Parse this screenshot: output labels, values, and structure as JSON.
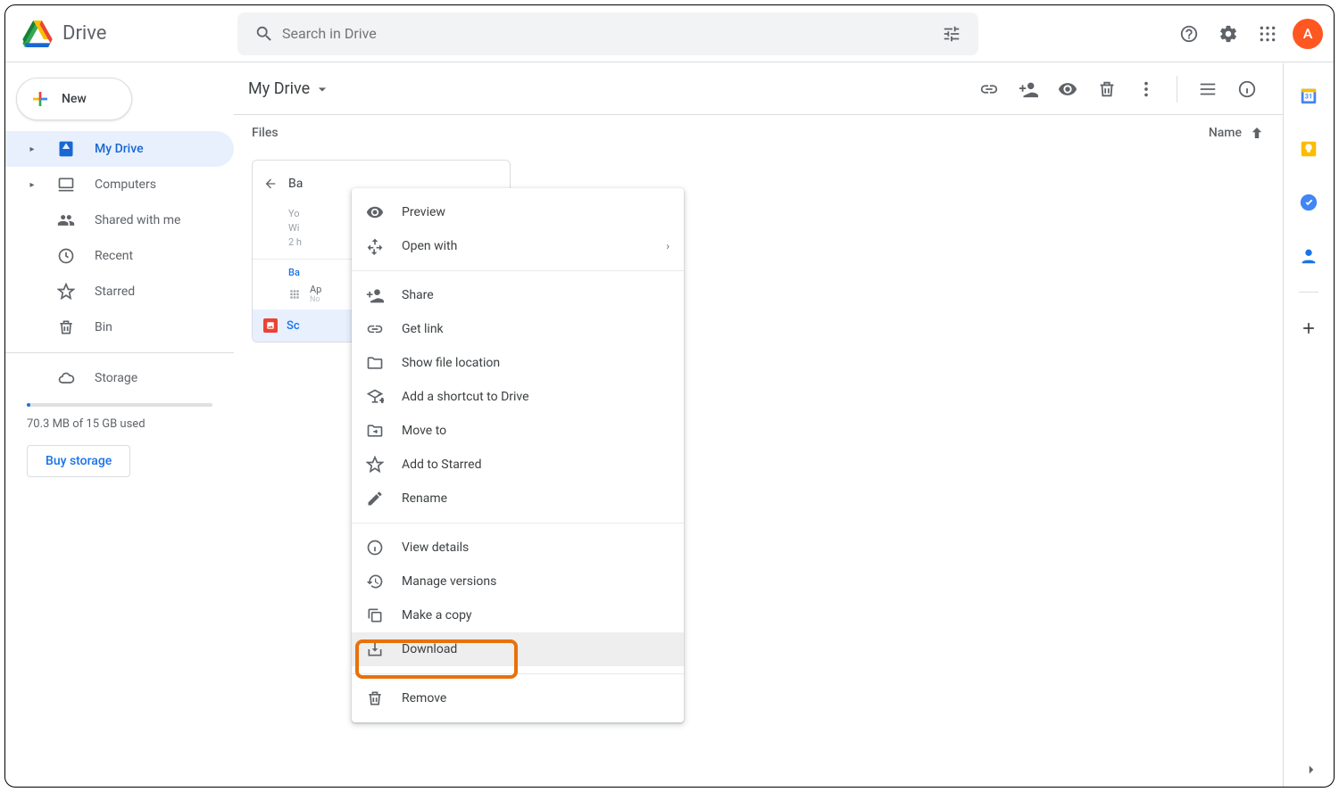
{
  "header": {
    "app_title": "Drive",
    "search_placeholder": "Search in Drive",
    "avatar_initial": "A"
  },
  "sidebar": {
    "new_label": "New",
    "items": [
      {
        "label": "My Drive"
      },
      {
        "label": "Computers"
      },
      {
        "label": "Shared with me"
      },
      {
        "label": "Recent"
      },
      {
        "label": "Starred"
      },
      {
        "label": "Bin"
      }
    ],
    "storage_label": "Storage",
    "storage_used": "70.3 MB of 15 GB used",
    "buy_label": "Buy storage"
  },
  "main": {
    "breadcrumb": "My Drive",
    "files_heading": "Files",
    "sort_label": "Name",
    "card": {
      "back_label": "Ba",
      "body_line1": "Yo",
      "body_line2": "Wi",
      "body_line3": "2 h",
      "section_title": "Ba",
      "app_label": "Ap",
      "app_sub": "No",
      "selected_label": "Sc"
    }
  },
  "context_menu": {
    "groups": [
      [
        {
          "label": "Preview",
          "icon": "eye"
        },
        {
          "label": "Open with",
          "icon": "open-with",
          "arrow": true
        }
      ],
      [
        {
          "label": "Share",
          "icon": "share"
        },
        {
          "label": "Get link",
          "icon": "link"
        },
        {
          "label": "Show file location",
          "icon": "folder"
        },
        {
          "label": "Add a shortcut to Drive",
          "icon": "shortcut"
        },
        {
          "label": "Move to",
          "icon": "move"
        },
        {
          "label": "Add to Starred",
          "icon": "star"
        },
        {
          "label": "Rename",
          "icon": "rename"
        }
      ],
      [
        {
          "label": "View details",
          "icon": "info"
        },
        {
          "label": "Manage versions",
          "icon": "history"
        },
        {
          "label": "Make a copy",
          "icon": "copy"
        },
        {
          "label": "Download",
          "icon": "download",
          "highlight": true
        }
      ],
      [
        {
          "label": "Remove",
          "icon": "trash"
        }
      ]
    ]
  },
  "rail": {
    "apps": [
      "calendar",
      "keep",
      "tasks",
      "contacts"
    ]
  }
}
